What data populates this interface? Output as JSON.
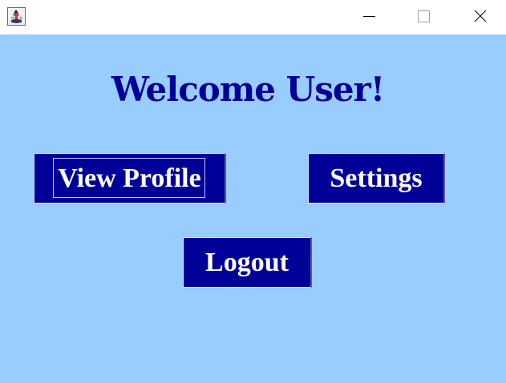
{
  "window": {
    "app_icon": "java-duke-icon",
    "controls": {
      "minimize_icon": "minimize-icon",
      "maximize_icon": "maximize-icon",
      "close_icon": "close-icon"
    }
  },
  "main": {
    "heading": "Welcome User!",
    "buttons": {
      "view_profile": "View Profile",
      "settings": "Settings",
      "logout": "Logout"
    },
    "focused_button": "view_profile"
  },
  "colors": {
    "background": "#99ccff",
    "accent": "#000099",
    "button_text": "#ffffff"
  }
}
